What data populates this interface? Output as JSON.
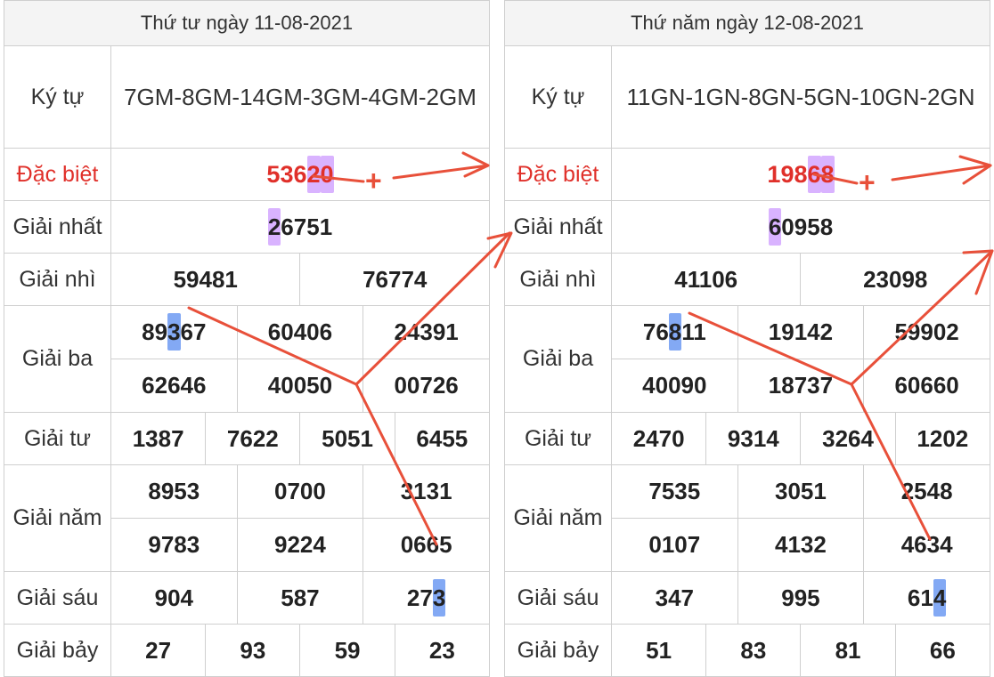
{
  "left": {
    "title": "Thứ tư ngày 11-08-2021",
    "labels": {
      "kytu": "Ký tự",
      "db": "Đặc biệt",
      "g1": "Giải nhất",
      "g2": "Giải nhì",
      "g3": "Giải ba",
      "g4": "Giải tư",
      "g5": "Giải năm",
      "g6": "Giải sáu",
      "g7": "Giải bảy"
    },
    "kytu": "7GM-8GM-14GM-3GM-4GM-2GM",
    "db": "53620",
    "g1": "26751",
    "g2": [
      "59481",
      "76774"
    ],
    "g3": [
      "89367",
      "60406",
      "24391",
      "62646",
      "40050",
      "00726"
    ],
    "g4": [
      "1387",
      "7622",
      "5051",
      "6455"
    ],
    "g5": [
      "8953",
      "0700",
      "3131",
      "9783",
      "9224",
      "0665"
    ],
    "g6": [
      "904",
      "587",
      "273"
    ],
    "g7": [
      "27",
      "93",
      "59",
      "23"
    ]
  },
  "right": {
    "title": "Thứ năm ngày 12-08-2021",
    "labels": {
      "kytu": "Ký tự",
      "db": "Đặc biệt",
      "g1": "Giải nhất",
      "g2": "Giải nhì",
      "g3": "Giải ba",
      "g4": "Giải tư",
      "g5": "Giải năm",
      "g6": "Giải sáu",
      "g7": "Giải bảy"
    },
    "kytu": "11GN-1GN-8GN-5GN-10GN-2GN",
    "db": "19868",
    "g1": "60958",
    "g2": [
      "41106",
      "23098"
    ],
    "g3": [
      "76811",
      "19142",
      "59902",
      "40090",
      "18737",
      "60660"
    ],
    "g4": [
      "2470",
      "9314",
      "3264",
      "1202"
    ],
    "g5": [
      "7535",
      "3051",
      "2548",
      "0107",
      "4132",
      "4634"
    ],
    "g6": [
      "347",
      "995",
      "614"
    ],
    "g7": [
      "51",
      "83",
      "81",
      "66"
    ]
  },
  "annotations": {
    "plus_symbol": "+",
    "arrow_color": "#e8503a",
    "highlight_purple": "#cc99ff",
    "highlight_blue": "#5a8cf0"
  }
}
